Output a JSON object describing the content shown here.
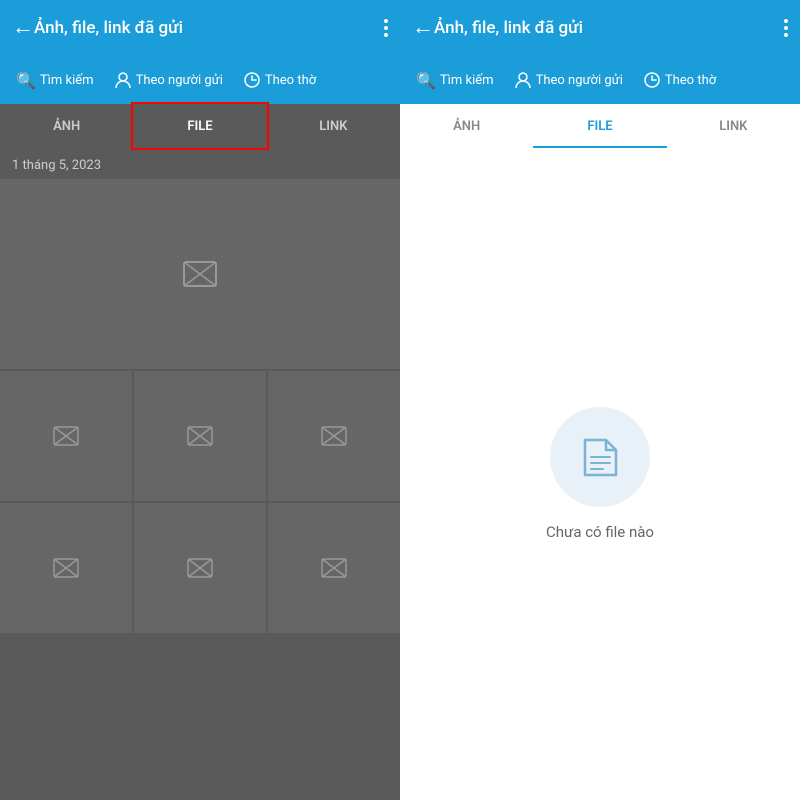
{
  "left": {
    "header": {
      "title": "Ảnh, file, link đã gửi",
      "back_label": "←",
      "more_label": "⋮"
    },
    "search": {
      "search_label": "Tìm kiếm",
      "sender_label": "Theo người gửi",
      "time_label": "Theo thờ"
    },
    "tabs": [
      {
        "label": "ẢNH",
        "active": false
      },
      {
        "label": "FILE",
        "active": true
      },
      {
        "label": "LINK",
        "active": false
      }
    ],
    "date_label": "1 tháng 5, 2023"
  },
  "right": {
    "header": {
      "title": "Ảnh, file, link đã gửi",
      "back_label": "←",
      "more_label": "⋮"
    },
    "search": {
      "search_label": "Tìm kiếm",
      "sender_label": "Theo người gửi",
      "time_label": "Theo thờ"
    },
    "tabs": [
      {
        "label": "ẢNH",
        "active": false
      },
      {
        "label": "FILE",
        "active": true
      },
      {
        "label": "LINK",
        "active": false
      }
    ],
    "empty_text": "Chưa có file nào"
  }
}
